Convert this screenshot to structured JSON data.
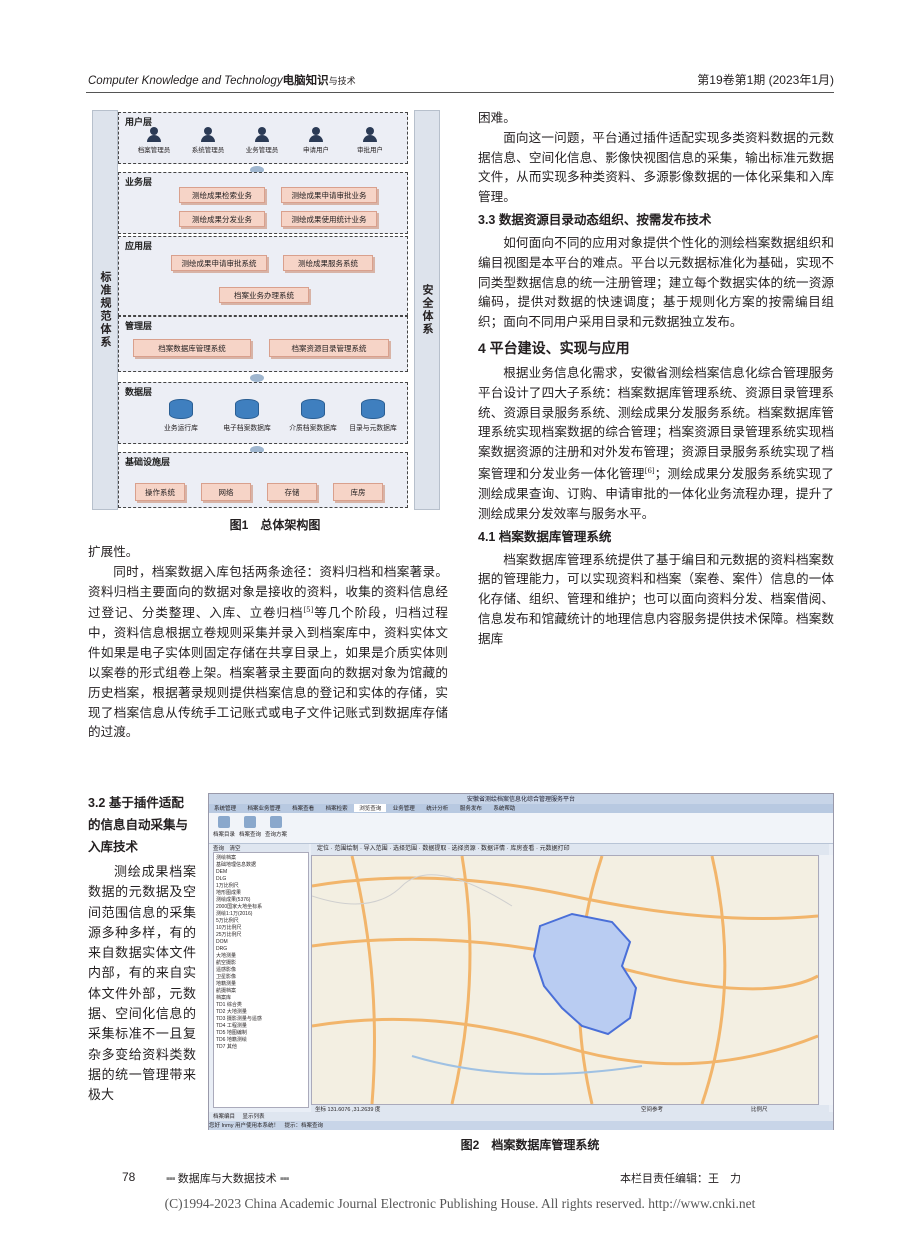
{
  "header": {
    "journal_en": "Computer Knowledge and Technology",
    "journal_cn": "电脑知识",
    "journal_cn_small": "与技术",
    "issue": "第19卷第1期 (2023年1月)"
  },
  "figure1": {
    "left_label": "标准规范体系",
    "right_label": "安全体系",
    "layers": {
      "user": {
        "title": "用户层",
        "users": [
          "档案管理员",
          "系统管理员",
          "业务管理员",
          "申请用户",
          "审批用户"
        ]
      },
      "business": {
        "title": "业务层",
        "boxes": [
          "测绘成果检索业务",
          "测绘成果申请审批业务",
          "测绘成果分发业务",
          "测绘成果使用统计业务"
        ]
      },
      "application": {
        "title": "应用层",
        "boxes": [
          "测绘成果申请审批系统",
          "测绘成果服务系统",
          "档案业务办理系统"
        ]
      },
      "management": {
        "title": "管理层",
        "boxes": [
          "档案数据库管理系统",
          "档案资源目录管理系统"
        ]
      },
      "data": {
        "title": "数据层",
        "dbs": [
          "业务运行库",
          "电子档案数据库",
          "介质档案数据库",
          "目录与元数据库"
        ]
      },
      "infra": {
        "title": "基础设施层",
        "boxes": [
          "操作系统",
          "网络",
          "存储",
          "库房"
        ]
      }
    },
    "caption": "图1　总体架构图"
  },
  "left_col": {
    "p0": "扩展性。",
    "p1_a": "同时，档案数据入库包括两条途径：资料归档和档案著录。资料归档主要面向的数据对象是接收的资料，收集的资料信息经过登记、分类整理、入库、立卷归档",
    "p1_ref": "[5]",
    "p1_b": "等几个阶段，归档过程中，资料信息根据立卷规则采集并录入到档案库中，资料实体文件如果是电子实体则固定存储在共享目录上，如果是介质实体则以案卷的形式组卷上架。档案著录主要面向的数据对象为馆藏的历史档案，根据著录规则提供档案信息的登记和实体的存储，实现了档案信息从传统手工记账式或电子文件记账式到数据库存储的过渡。",
    "s32_heading": "3.2 基于插件适配的信息自动采集与入库技术",
    "s32_text": "测绘成果档案数据的元数据及空间范围信息的采集源多种多样，有的来自数据实体文件内部，有的来自实体文件外部，元数据、空间化信息的采集标准不一且复杂多变给资料类数据的统一管理带来极大"
  },
  "right_col": {
    "r0": "困难。",
    "r1": "面向这一问题，平台通过插件适配实现多类资料数据的元数据信息、空间化信息、影像快视图信息的采集，输出标准元数据文件，从而实现多种类资料、多源影像数据的一体化采集和入库管理。",
    "s33_heading": "3.3 数据资源目录动态组织、按需发布技术",
    "r2": "如何面向不同的应用对象提供个性化的测绘档案数据组织和编目视图是本平台的难点。平台以元数据标准化为基础，实现不同类型数据信息的统一注册管理；建立每个数据实体的统一资源编码，提供对数据的快速调度；基于规则化方案的按需编目组织；面向不同用户采用目录和元数据独立发布。",
    "s4_heading": "4 平台建设、实现与应用",
    "r3_a": "根据业务信息化需求，安徽省测绘档案信息化综合管理服务平台设计了四大子系统：档案数据库管理系统、资源目录管理系统、资源目录服务系统、测绘成果分发服务系统。档案数据库管理系统实现档案数据的综合管理；档案资源目录管理系统实现档案数据资源的注册和对外发布管理；资源目录服务系统实现了档案管理和分发业务一体化管理",
    "r3_ref": "[6]",
    "r3_b": "；测绘成果分发服务系统实现了测绘成果查询、订购、申请审批的一体化业务流程办理，提升了测绘成果分发效率与服务水平。",
    "s41_heading": "4.1 档案数据库管理系统",
    "r4": "档案数据库管理系统提供了基于编目和元数据的资料档案数据的管理能力，可以实现资料和档案（案卷、案件）信息的一体化存储、组织、管理和维护；也可以面向资料分发、档案借阅、信息发布和馆藏统计的地理信息内容服务提供技术保障。档案数据库"
  },
  "figure2": {
    "window_title": "安徽省测绘档案信息化综合管理服务平台",
    "tabs": [
      "系统管理",
      "档案业务管理",
      "档案查看",
      "档案检索",
      "浏览查询",
      "业务管理",
      "统计分析",
      "服务发布",
      "系统帮助"
    ],
    "ribbon": [
      "档案目录",
      "档案查询",
      "查询方案"
    ],
    "tree_tool": "查询　清空",
    "map_tool": "定位 · 范围绘制 · 导入范围 · 选择范围 · 数据提取 · 选择资源 · 数据详情 · 库房查看 · 元数据打印",
    "tree": [
      "测绘档案",
      " 基础地理信息数据",
      "  DEM",
      "  DLG",
      "   1万比例尺",
      "    地形图成果",
      "    测绘成果(5376)",
      "    2000国家大地坐标系",
      "    测绘1:1万(2016)",
      "   5万比例尺",
      "   10万比例尺",
      "   25万比例尺",
      "  DOM",
      "  DRG",
      " 大地测量",
      " 航空摄影",
      " 遥感影像",
      " 卫星影像",
      " 地籍测量",
      " 航摄档案",
      " 档案库",
      "  TD1 综合类",
      "  TD2 大地测量",
      "  TD3 摄影测量与遥感",
      "  TD4 工程测量",
      "  TD5 地图编制",
      "  TD6 地籍测绘",
      "  TD7 其他"
    ],
    "coords": "坐标 131.6076 ,31.2639 度",
    "space_ref": "空间参考",
    "scale": "比例尺",
    "bottom_tabs": [
      "档案编目",
      "显示列表"
    ],
    "status": "您好 Inmy 用户使用本系统！　提示：档案查询",
    "caption": "图2　档案数据库管理系统"
  },
  "footer": {
    "page": "78",
    "column": "数据库与大数据技术",
    "editor": "本栏目责任编辑：王　力",
    "copyright": "(C)1994-2023 China Academic Journal Electronic Publishing House. All rights reserved.    http://www.cnki.net"
  }
}
